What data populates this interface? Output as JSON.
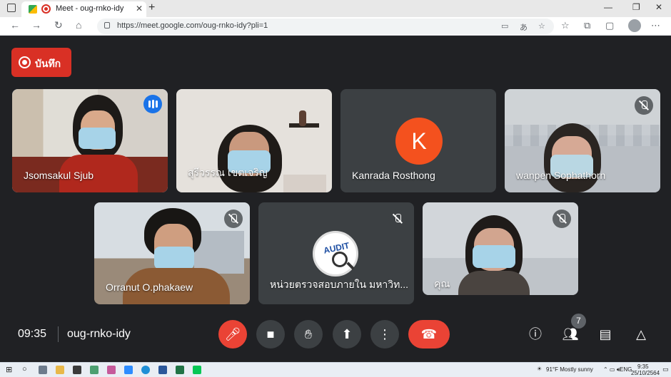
{
  "browser": {
    "tab_title": "Meet - oug-rnko-idy",
    "tab_close": "✕",
    "new_tab": "+",
    "url": "https://meet.google.com/oug-rnko-idy?pli=1",
    "window_controls": [
      "—",
      "❐",
      "✕"
    ]
  },
  "recording": {
    "label": "บันทึก"
  },
  "participants": [
    {
      "name": "Jsomsakul Sjub",
      "state": "speaking"
    },
    {
      "name": "สุรีวรรณ เขตเจริญ",
      "state": "video"
    },
    {
      "name": "Kanrada Rosthong",
      "state": "avatar",
      "initial": "K",
      "avatar_color": "#f4511e"
    },
    {
      "name": "wanpen Sophathorn",
      "state": "muted"
    },
    {
      "name": "Orranut O.phakaew",
      "state": "muted"
    },
    {
      "name": "หน่วยตรวจสอบภายใน มหาวิท...",
      "state": "muted",
      "logo_text": "AUDIT"
    },
    {
      "name": "คุณ",
      "state": "muted"
    }
  ],
  "meeting": {
    "time": "09:35",
    "code": "oug-rnko-idy",
    "participant_count": "7"
  },
  "taskbar": {
    "weather": "91°F  Mostly sunny",
    "lang": "ENG",
    "clock_time": "9:35",
    "clock_date": "25/10/2564"
  },
  "colors": {
    "accent": "#8ab4f8",
    "danger": "#ea4335",
    "record": "#d93025",
    "speaking": "#1a73e8"
  }
}
